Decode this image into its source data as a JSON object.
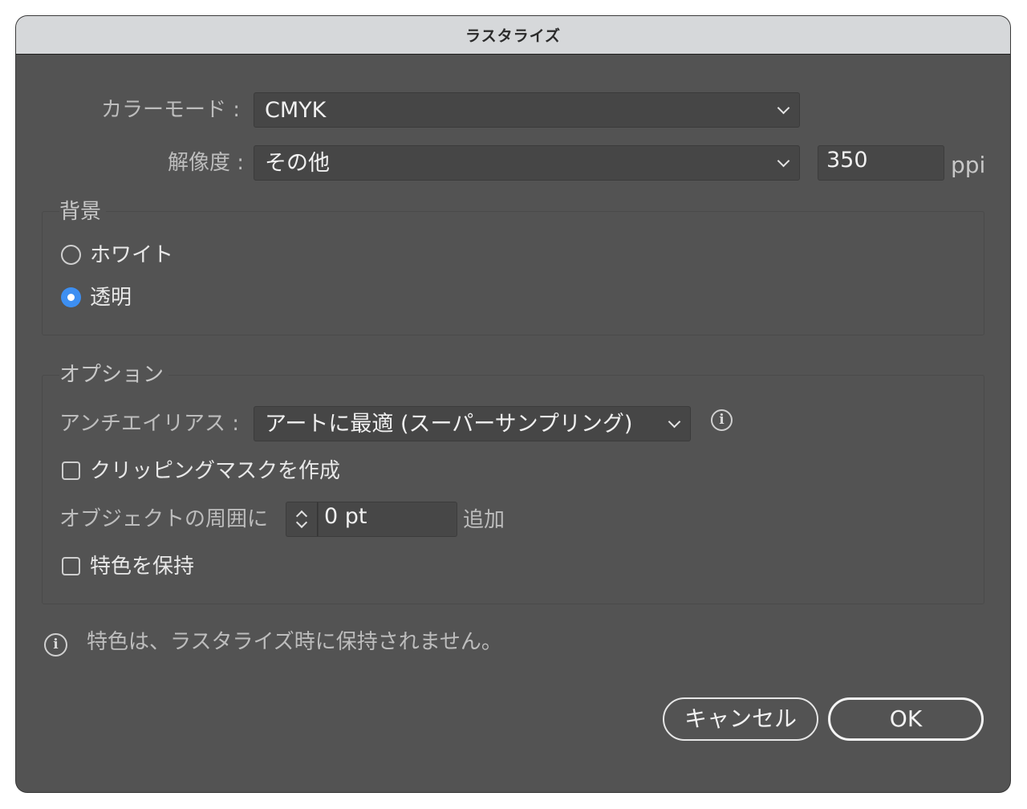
{
  "window": {
    "title": "ラスタライズ"
  },
  "color_mode": {
    "label": "カラーモード :",
    "value": "CMYK"
  },
  "resolution": {
    "label": "解像度 :",
    "value": "その他",
    "ppi_value": "350",
    "unit": "ppi"
  },
  "background": {
    "title": "背景",
    "options": [
      {
        "label": "ホワイト",
        "selected": false
      },
      {
        "label": "透明",
        "selected": true
      }
    ]
  },
  "options": {
    "title": "オプション",
    "antialias": {
      "label": "アンチエイリアス :",
      "value": "アートに最適 (スーパーサンプリング)"
    },
    "clipping_mask": {
      "label": "クリッピングマスクを作成",
      "checked": false
    },
    "padding": {
      "label": "オブジェクトの周囲に",
      "value": "0 pt",
      "suffix": "追加"
    },
    "keep_spot": {
      "label": "特色を保持",
      "checked": false
    }
  },
  "notice": {
    "text": "特色は、ラスタライズ時に保持されません。"
  },
  "buttons": {
    "cancel": "キャンセル",
    "ok": "OK"
  },
  "icons": {
    "info": "info-icon",
    "radio_selected_color": "#3d8ff2"
  }
}
